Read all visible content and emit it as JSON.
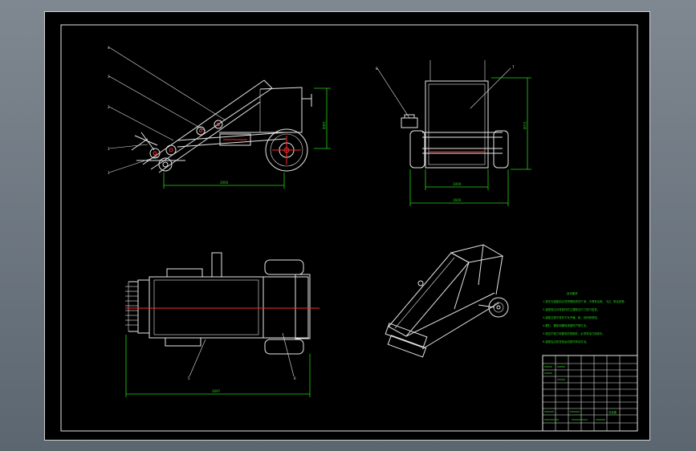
{
  "drawing": {
    "background_color": "#000000",
    "line_color": "#e6e6e6",
    "dimension_color": "#27d31b",
    "centerline_color": "#ff2a2a"
  },
  "side_view": {
    "balloons": [
      "4",
      "3",
      "2",
      "1",
      "1"
    ],
    "dimensions": {
      "length": "2660",
      "height": "1060"
    }
  },
  "end_view": {
    "balloons": [
      "8",
      "7"
    ],
    "dimensions": {
      "inner_width": "1000",
      "outer_width": "1600",
      "height": "1100"
    }
  },
  "top_view": {
    "balloons": [
      "5",
      "6"
    ],
    "dimensions": {
      "length": "2697"
    }
  },
  "notes": {
    "heading": "技术要求",
    "lines": [
      "1.零件在装配前必须清理和清洗干净，不得有毛刺、飞边、氧化皮等。",
      "2.装配前应对零部件的主要配合尺寸进行复查。",
      "3.装配过程中零件不允许磕、碰、划伤和锈蚀。",
      "4.螺钉、螺栓和螺母紧固时严禁打击。",
      "5.规定拧紧力矩要求的紧固件，必须采用力矩扳手。",
      "6.装配后应检查各运动部件转动灵活。"
    ]
  },
  "title_block": {
    "title": "总装图"
  }
}
